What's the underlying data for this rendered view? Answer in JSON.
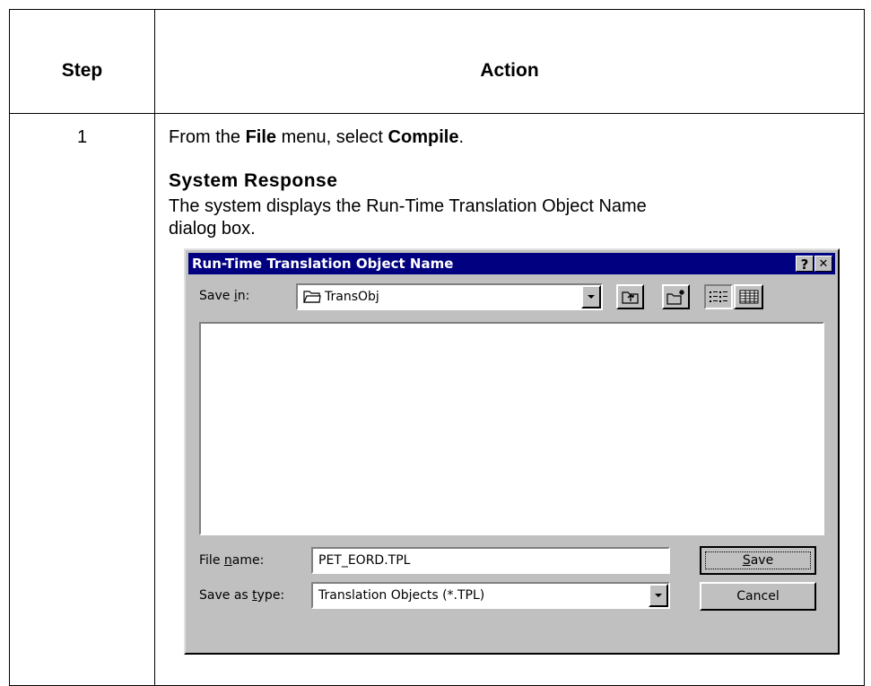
{
  "table": {
    "header_step": "Step",
    "header_action": "Action",
    "step_number": "1",
    "instruction": {
      "prefix": "From the ",
      "menu": "File",
      "middle": " menu, select ",
      "command": "Compile",
      "suffix": "."
    },
    "system_response_title": "System Response",
    "system_response_text": "The system displays the Run-Time Translation Object Name dialog box."
  },
  "dialog": {
    "title": "Run-Time Translation Object Name",
    "help_label": "?",
    "close_label": "✕",
    "save_in": {
      "label_pre": "Save ",
      "label_accel": "i",
      "label_post": "n:",
      "value": "TransObj"
    },
    "file_name": {
      "label_pre": "File ",
      "label_accel": "n",
      "label_post": "ame:",
      "value": "PET_EORD.TPL"
    },
    "save_as_type": {
      "label_pre": "Save as ",
      "label_accel": "t",
      "label_post": "ype:",
      "value": "Translation Objects (*.TPL)"
    },
    "save_button": {
      "accel": "S",
      "rest": "ave"
    },
    "cancel_button": "Cancel",
    "icons": {
      "up_folder": "up-one-level-icon",
      "new_folder": "create-new-folder-icon",
      "list_view": "list-view-icon",
      "details_view": "details-view-icon"
    }
  }
}
